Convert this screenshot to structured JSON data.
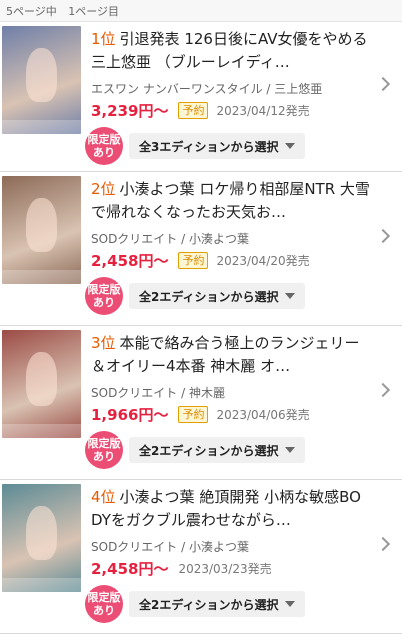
{
  "page_info": {
    "pages": "5ページ中",
    "current": "1ページ目"
  },
  "items": [
    {
      "rank": "1位",
      "title": "引退発表 126日後にAV女優をやめる三上悠亜 （ブルーレイディ…",
      "maker": "エスワン ナンバーワンスタイル / 三上悠亜",
      "price": "3,239円〜",
      "badge": "予約",
      "date": "2023/04/12発売",
      "limited": [
        "限定版",
        "あり"
      ],
      "edition": "全3エディションから選択",
      "thumb_color": "#6f7fa8"
    },
    {
      "rank": "2位",
      "title": "小湊よつ葉 ロケ帰り相部屋NTR 大雪で帰れなくなったお天気お…",
      "maker": "SODクリエイト / 小湊よつ葉",
      "price": "2,458円〜",
      "badge": "予約",
      "date": "2023/04/20発売",
      "limited": [
        "限定版",
        "あり"
      ],
      "edition": "全2エディションから選択",
      "thumb_color": "#8c6a57"
    },
    {
      "rank": "3位",
      "title": "本能で絡み合う極上のランジェリー＆オイリー4本番 神木麗 オ…",
      "maker": "SODクリエイト / 神木麗",
      "price": "1,966円〜",
      "badge": "予約",
      "date": "2023/04/06発売",
      "limited": [
        "限定版",
        "あり"
      ],
      "edition": "全2エディションから選択",
      "thumb_color": "#9b4b45"
    },
    {
      "rank": "4位",
      "title": "小湊よつ葉 絶頂開発 小柄な敏感BODYをガクブル震わせながら…",
      "maker": "SODクリエイト / 小湊よつ葉",
      "price": "2,458円〜",
      "badge": "",
      "date": "2023/03/23発売",
      "limited": [
        "限定版",
        "あり"
      ],
      "edition": "全2エディションから選択",
      "thumb_color": "#5c8b95"
    }
  ]
}
